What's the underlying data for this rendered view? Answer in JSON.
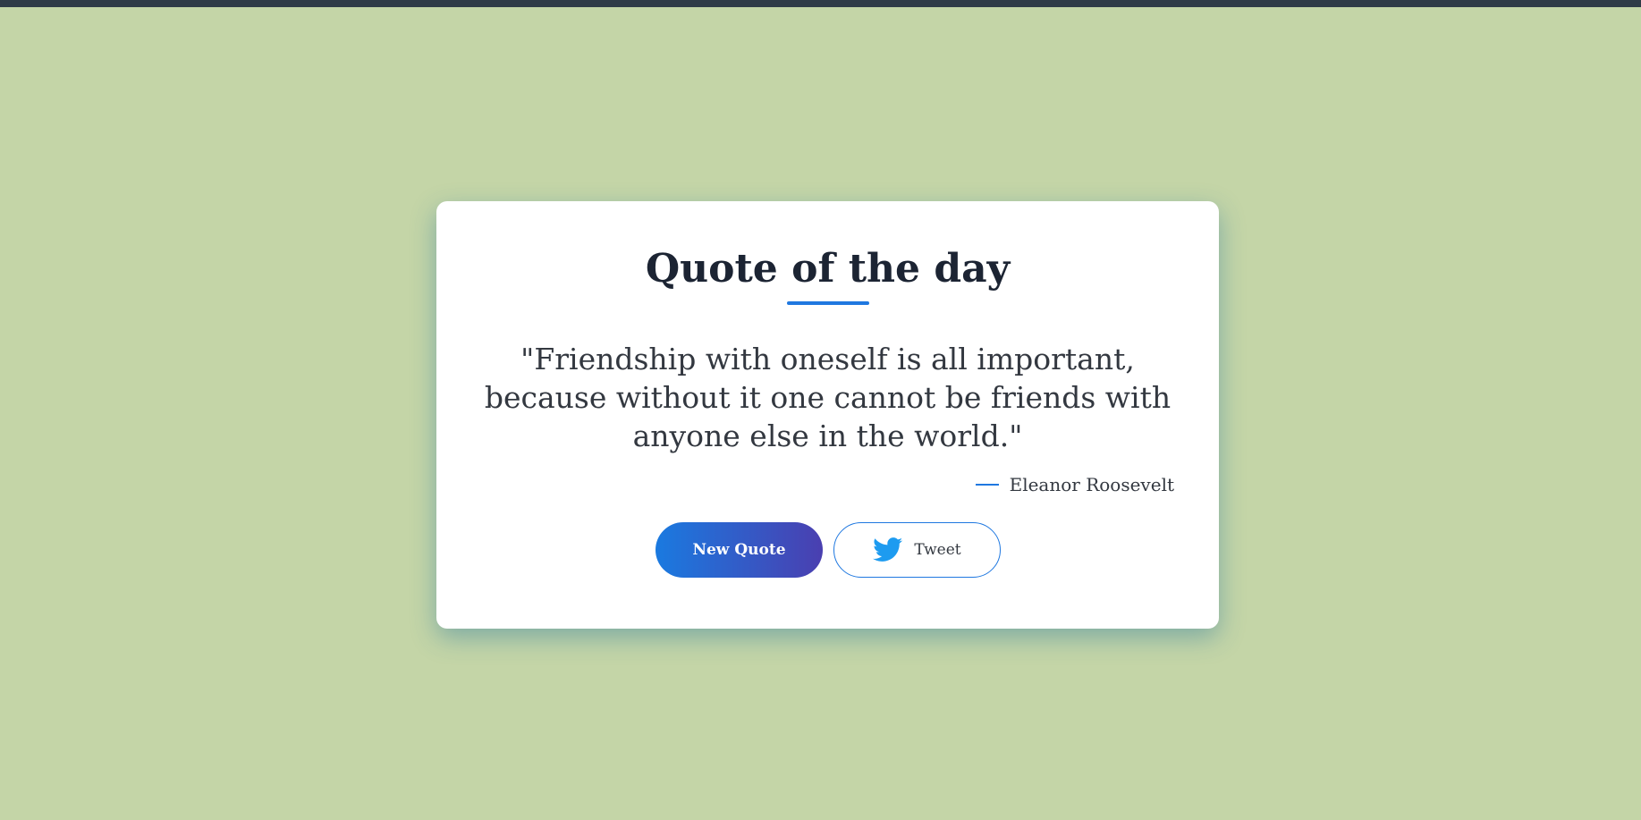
{
  "page": {
    "background_color": "#c4d5a7",
    "topbar_color": "#2f3b47"
  },
  "card": {
    "title": "Quote of the day",
    "quote_text": "\"Friendship with oneself is all important, because without it one cannot be friends with anyone else in the world.\"",
    "author": "Eleanor Roosevelt",
    "accent_color": "#1f78e0"
  },
  "actions": {
    "new_quote_label": "New Quote",
    "tweet_label": "Tweet",
    "tweet_icon": "twitter-bird-icon",
    "gradient_start": "#1a7ae0",
    "gradient_end": "#4a3fb0"
  }
}
